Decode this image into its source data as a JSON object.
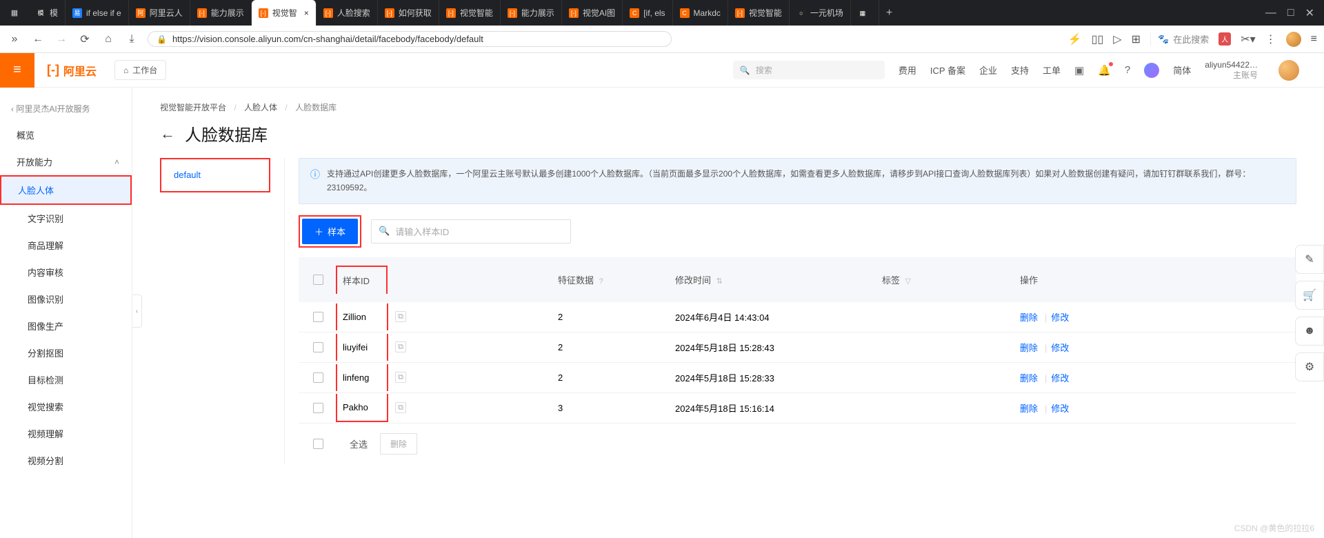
{
  "browser": {
    "tabs": [
      {
        "label": "模",
        "fav": "模",
        "favClass": "dark"
      },
      {
        "label": "if else if e",
        "fav": "易",
        "favClass": "blue"
      },
      {
        "label": "阿里云人",
        "fav": "阿",
        "favClass": "orange"
      },
      {
        "label": "能力展示",
        "fav": "[-]",
        "favClass": "orange"
      },
      {
        "label": "视觉智",
        "fav": "[-]",
        "favClass": "orange",
        "active": true
      },
      {
        "label": "人脸搜索",
        "fav": "[-]",
        "favClass": "orange"
      },
      {
        "label": "如何获取",
        "fav": "[-]",
        "favClass": "orange"
      },
      {
        "label": "视觉智能",
        "fav": "[-]",
        "favClass": "orange"
      },
      {
        "label": "能力展示",
        "fav": "[-]",
        "favClass": "orange"
      },
      {
        "label": "视觉AI图",
        "fav": "[-]",
        "favClass": "orange"
      },
      {
        "label": "[if, els",
        "fav": "C",
        "favClass": "orange"
      },
      {
        "label": "Markdc",
        "fav": "C",
        "favClass": "orange"
      },
      {
        "label": "视觉智能",
        "fav": "[-]",
        "favClass": "orange"
      },
      {
        "label": "一元机场",
        "fav": "○",
        "favClass": "dark"
      },
      {
        "label": "",
        "fav": "▦",
        "favClass": "dark"
      }
    ],
    "window_controls": {
      "min": "—",
      "max": "□",
      "close": "✕"
    },
    "url": "https://vision.console.aliyun.com/cn-shanghai/detail/facebody/facebody/default",
    "search_placeholder": "在此搜索",
    "pdf_badge": "人"
  },
  "ali_header": {
    "logo_text": "阿里云",
    "workspace": "工作台",
    "search_placeholder": "搜索",
    "links": [
      "费用",
      "ICP 备案",
      "企业",
      "支持",
      "工单"
    ],
    "lang": "简体",
    "account_name": "aliyun54422…",
    "account_role": "主账号"
  },
  "sidebar": {
    "back": "阿里灵杰AI开放服务",
    "items": [
      {
        "label": "概览"
      },
      {
        "label": "开放能力",
        "group": true
      },
      {
        "label": "人脸人体",
        "active": true,
        "highlight": true
      },
      {
        "label": "文字识别",
        "sub": true
      },
      {
        "label": "商品理解",
        "sub": true
      },
      {
        "label": "内容审核",
        "sub": true
      },
      {
        "label": "图像识别",
        "sub": true
      },
      {
        "label": "图像生产",
        "sub": true
      },
      {
        "label": "分割抠图",
        "sub": true
      },
      {
        "label": "目标检测",
        "sub": true
      },
      {
        "label": "视觉搜索",
        "sub": true
      },
      {
        "label": "视频理解",
        "sub": true
      },
      {
        "label": "视频分割",
        "sub": true
      }
    ]
  },
  "breadcrumb": {
    "a": "视觉智能开放平台",
    "b": "人脸人体",
    "c": "人脸数据库"
  },
  "page_title": "人脸数据库",
  "db_tab": "default",
  "banner": "支持通过API创建更多人脸数据库，一个阿里云主账号默认最多创建1000个人脸数据库。（当前页面最多显示200个人脸数据库，如需查看更多人脸数据库，请移步到API接口查询人脸数据库列表）如果对人脸数据创建有疑问，请加钉钉群联系我们，群号：23109592。",
  "toolbar": {
    "add_sample": "样本",
    "search_placeholder": "请输入样本ID"
  },
  "table": {
    "headers": {
      "id": "样本ID",
      "feat": "特征数据",
      "time": "修改时间",
      "tag": "标签",
      "ops": "操作"
    },
    "rows": [
      {
        "id": "Zillion",
        "feat": "2",
        "time": "2024年6月4日 14:43:04"
      },
      {
        "id": "liuyifei",
        "feat": "2",
        "time": "2024年5月18日 15:28:43"
      },
      {
        "id": "linfeng",
        "feat": "2",
        "time": "2024年5月18日 15:28:33"
      },
      {
        "id": "Pakho",
        "feat": "3",
        "time": "2024年5月18日 15:16:14"
      }
    ],
    "ops": {
      "delete": "删除",
      "edit": "修改"
    },
    "select_all": "全选",
    "batch_delete": "删除"
  },
  "watermark": "CSDN @黄色的拉拉6"
}
